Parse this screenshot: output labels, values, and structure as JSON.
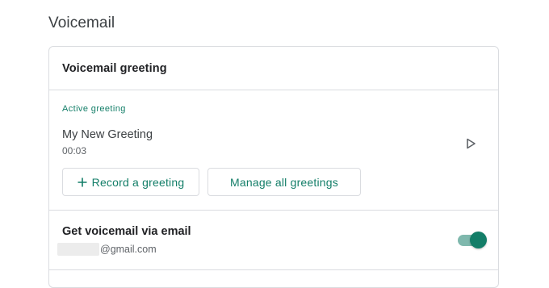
{
  "page": {
    "title": "Voicemail"
  },
  "voicemail_greeting": {
    "header": "Voicemail greeting",
    "active_label": "Active greeting",
    "greeting_name": "My New Greeting",
    "duration": "00:03",
    "play_icon": "play-icon",
    "record_button_label": "Record a greeting",
    "record_icon": "plus-icon",
    "manage_button_label": "Manage all greetings"
  },
  "email_voicemail": {
    "title": "Get voicemail via email",
    "email_suffix": "@gmail.com",
    "enabled": true
  },
  "colors": {
    "accent": "#137e68",
    "toggle_track": "#7fb8ad",
    "border": "#dadce0"
  }
}
